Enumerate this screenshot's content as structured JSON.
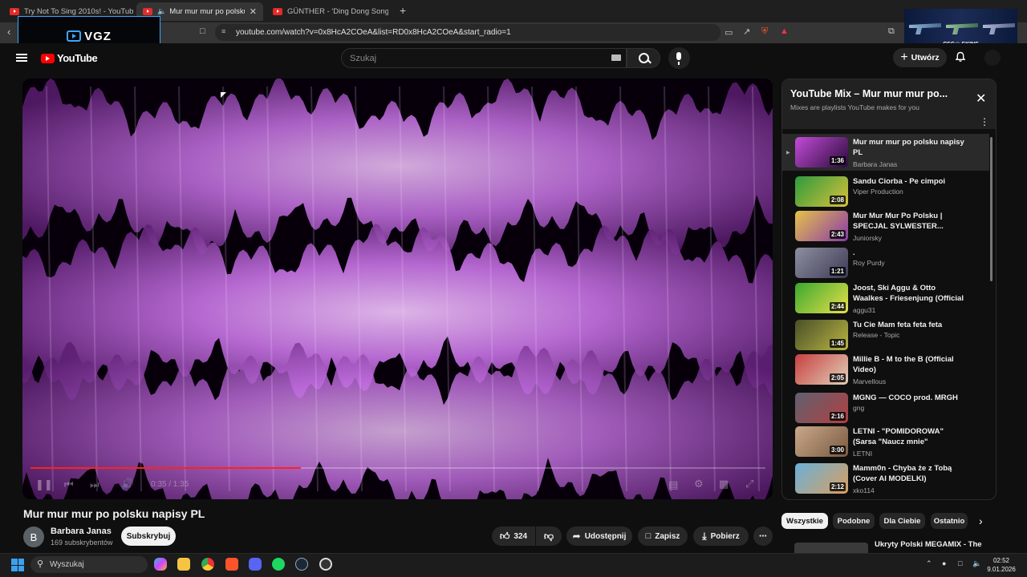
{
  "browser": {
    "tabs": [
      {
        "title": "Try Not To Sing 2010s! - YouTube",
        "active": false
      },
      {
        "title": "Mur mur mur po polsku napi",
        "active": true
      },
      {
        "title": "GÜNTHER - 'Ding Dong Song' | Vide",
        "active": false
      }
    ],
    "url": "youtube.com/watch?v=0x8HcA2COeA&list=RD0x8HcA2COeA&start_radio=1"
  },
  "overlays": {
    "vgz_label": "VGZ",
    "csgo_label": "CSG◎ SKINS"
  },
  "youtube": {
    "logo_text": "YouTube",
    "search_placeholder": "Szukaj",
    "create_label": "Utwórz"
  },
  "player": {
    "time_label": "0:35 / 1:35",
    "progress_fraction": 0.368
  },
  "video": {
    "title": "Mur mur mur po polsku napisy PL",
    "channel_initial": "B",
    "channel_name": "Barbara Janas",
    "subscribers": "169 subskrybentów",
    "subscribe_label": "Subskrybuj",
    "likes": "324",
    "share_label": "Udostępnij",
    "save_label": "Zapisz",
    "download_label": "Pobierz"
  },
  "playlist": {
    "title": "YouTube Mix – Mur mur mur po...",
    "subtitle": "Mixes are playlists YouTube makes for you",
    "items": [
      {
        "title": "Mur mur mur po polsku napisy PL",
        "channel": "Barbara Janas",
        "duration": "1:36",
        "current": true
      },
      {
        "title": "Sandu Ciorba - Pe cimpoi",
        "channel": "Viper Production",
        "duration": "2:08"
      },
      {
        "title": "Mur Mur Mur Po Polsku | SPECJAL SYLWESTER...",
        "channel": "Juniorsky",
        "duration": "2:43"
      },
      {
        "title": ".",
        "channel": "Roy Purdy",
        "duration": "1:21"
      },
      {
        "title": "Joost, Ski Aggu & Otto Waalkes - Friesenjung (Official Video)",
        "channel": "aggu31",
        "duration": "2:44"
      },
      {
        "title": "Tu Cie Mam feta feta feta",
        "channel": "Release - Topic",
        "duration": "1:45"
      },
      {
        "title": "Millie B - M to the B (Official Video)",
        "channel": "Marvellous",
        "duration": "2:05"
      },
      {
        "title": "MGNG — COCO prod. MRGH",
        "channel": "gng",
        "duration": "2:16"
      },
      {
        "title": "LETNI - \"POMIDOROWA\"(Sarsa \"Naucz mnie\" PARODIA)",
        "channel": "LETNI",
        "duration": "3:00"
      },
      {
        "title": "Mamm0n - Chyba że z Tobą (Cover AI MODELKI)",
        "channel": "xko114",
        "duration": "2:12"
      }
    ]
  },
  "chips": [
    "Wszystkie",
    "Podobne",
    "Dla Ciebie",
    "Ostatnio"
  ],
  "recommended_title": "Ukryty Polski MEGAMIX - The",
  "taskbar": {
    "search_label": "Wyszukaj",
    "time": "02:52",
    "date": "9.01.2026"
  },
  "colors": {
    "accent_red": "#ff0000",
    "wave_purple": "#d58ef0"
  }
}
